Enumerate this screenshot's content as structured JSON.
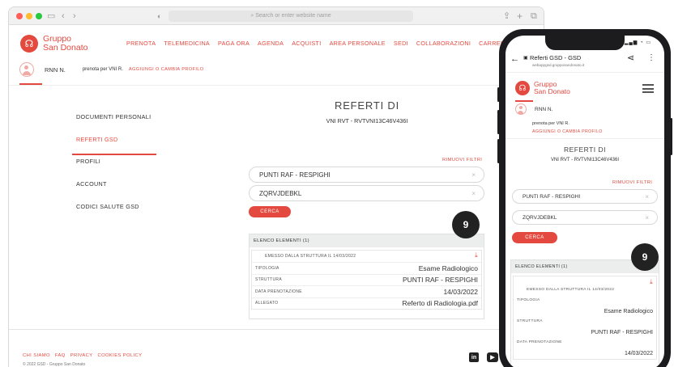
{
  "browser": {
    "url_placeholder": "Search or enter website name"
  },
  "brand": {
    "logo_glyph": "☊",
    "name_line1": "Gruppo",
    "name_line2": "San Donato",
    "accent": "#e4493f"
  },
  "nav": {
    "items": [
      "PRENOTA",
      "TELEMEDICINA",
      "PAGA ORA",
      "AGENDA",
      "ACQUISTI",
      "AREA PERSONALE",
      "SEDI",
      "COLLABORAZIONI",
      "CARRELLO"
    ]
  },
  "user": {
    "name": "RNN N.",
    "prenota_for": "prenota per VNI R.",
    "change_profile": "AGGIUNGI O CAMBIA PROFILO"
  },
  "sidebar": {
    "items": [
      {
        "label": "DOCUMENTI PERSONALI"
      },
      {
        "label": "REFERTI GSD"
      },
      {
        "label": "PROFILI"
      },
      {
        "label": "ACCOUNT"
      },
      {
        "label": "CODICI SALUTE GSD"
      }
    ],
    "active_index": 1
  },
  "main": {
    "title": "REFERTI DI",
    "subtitle": "VNI RVT - RVTVNI13C46V436I",
    "remove_filters": "RIMUOVI FILTRI",
    "filter1": "PUNTI RAF - RESPIGHI",
    "filter2": "ZQRVJDEBKL",
    "clear_glyph": "×",
    "search_button": "CERCA"
  },
  "results": {
    "count_badge": "9",
    "list_header": "ELENCO ELEMENTI (1)",
    "issued": "EMESSO DALLA STRUTTURA IL 14/03/2022",
    "rows": [
      {
        "key": "TIPOLOGIA",
        "value": "Esame Radiologico"
      },
      {
        "key": "STRUTTURA",
        "value": "PUNTI RAF - RESPIGHI"
      },
      {
        "key": "DATA PRENOTAZIONE",
        "value": "14/03/2022"
      },
      {
        "key": "ALLEGATO",
        "value": "Referto di Radiologia.pdf"
      }
    ]
  },
  "footer": {
    "links": [
      "CHI SIAMO",
      "FAQ",
      "PRIVACY",
      "COOKIES POLICY"
    ],
    "copyright": "© 2022 GSD - Gruppo San Donato",
    "social_in": "in",
    "social_yt": "▶"
  },
  "mobile": {
    "title": "Referti GSD - GSD",
    "url": "webappgsd.grupposandonato.it",
    "h1": "REFERTI DI",
    "subtitle": "VNI RVT - RVTVNI13C46V436I",
    "prenota_for": "prenota per VNI R.",
    "list_header": "ELENCO ELEMENTI (1)"
  }
}
